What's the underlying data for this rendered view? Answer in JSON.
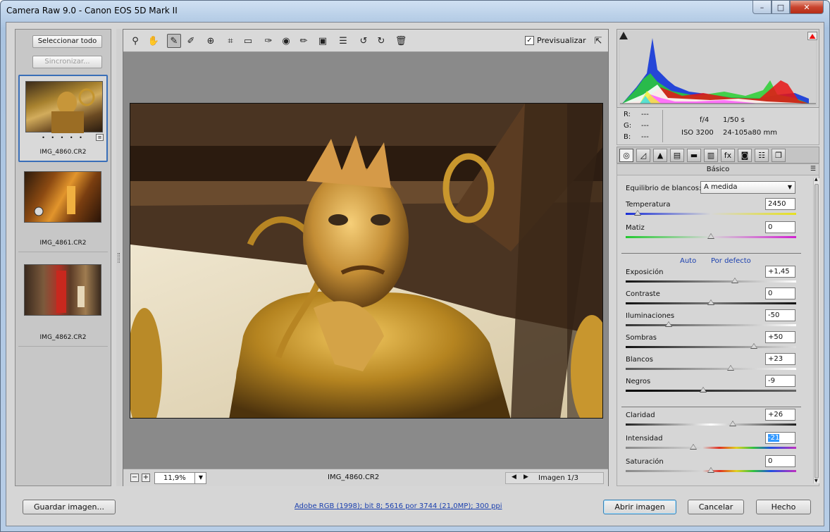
{
  "window": {
    "title": "Camera Raw 9.0 -  Canon EOS 5D Mark II",
    "min": "–",
    "max": "□",
    "close": "✕"
  },
  "filmstrip": {
    "select_all": "Seleccionar todo",
    "sync": "Sincronizar...",
    "items": [
      {
        "name": "IMG_4860.CR2",
        "rating": "• • • • •"
      },
      {
        "name": "IMG_4861.CR2"
      },
      {
        "name": "IMG_4862.CR2"
      }
    ]
  },
  "toolbar": {
    "preview_label": "Previsualizar",
    "preview_checked": "✓",
    "tools": [
      "zoom-icon",
      "hand-icon",
      "white-balance-icon",
      "color-sampler-icon",
      "target-adjust-icon",
      "crop-icon",
      "straighten-icon",
      "spot-removal-icon",
      "red-eye-icon",
      "adjustment-brush-icon",
      "graduated-filter-icon",
      "preferences-icon",
      "rotate-left-icon",
      "rotate-right-icon",
      "trash-icon"
    ]
  },
  "status": {
    "zoom": "11,9%",
    "filename": "IMG_4860.CR2",
    "image_count": "Imagen 1/3",
    "zoom_out": "−",
    "zoom_in": "+",
    "prev": "◀",
    "next": "▶"
  },
  "info": {
    "r_label": "R:",
    "g_label": "G:",
    "b_label": "B:",
    "r": "---",
    "g": "---",
    "b": "---",
    "aperture": "f/4",
    "shutter": "1/50 s",
    "iso": "ISO 3200",
    "lens": "24-105a80 mm"
  },
  "panel": {
    "title": "Básico",
    "wb_label": "Equilibrio de blancos:",
    "wb_value": "A medida",
    "auto": "Auto",
    "default": "Por defecto",
    "sliders": [
      {
        "label": "Temperatura",
        "value": "2450",
        "pos": 0.07
      },
      {
        "label": "Matiz",
        "value": "0",
        "pos": 0.5
      },
      {
        "label": "Exposición",
        "value": "+1,45",
        "pos": 0.64
      },
      {
        "label": "Contraste",
        "value": "0",
        "pos": 0.5
      },
      {
        "label": "Iluminaciones",
        "value": "-50",
        "pos": 0.25
      },
      {
        "label": "Sombras",
        "value": "+50",
        "pos": 0.75
      },
      {
        "label": "Blancos",
        "value": "+23",
        "pos": 0.615
      },
      {
        "label": "Negros",
        "value": "-9",
        "pos": 0.455
      },
      {
        "label": "Claridad",
        "value": "+26",
        "pos": 0.63
      },
      {
        "label": "Intensidad",
        "value": "-21",
        "pos": 0.395
      },
      {
        "label": "Saturación",
        "value": "0",
        "pos": 0.5
      }
    ]
  },
  "bottom": {
    "save": "Guardar imagen...",
    "workflow": "Adobe RGB (1998); bit 8; 5616 por 3744 (21,0MP); 300 ppi",
    "open": "Abrir imagen",
    "cancel": "Cancelar",
    "done": "Hecho"
  }
}
